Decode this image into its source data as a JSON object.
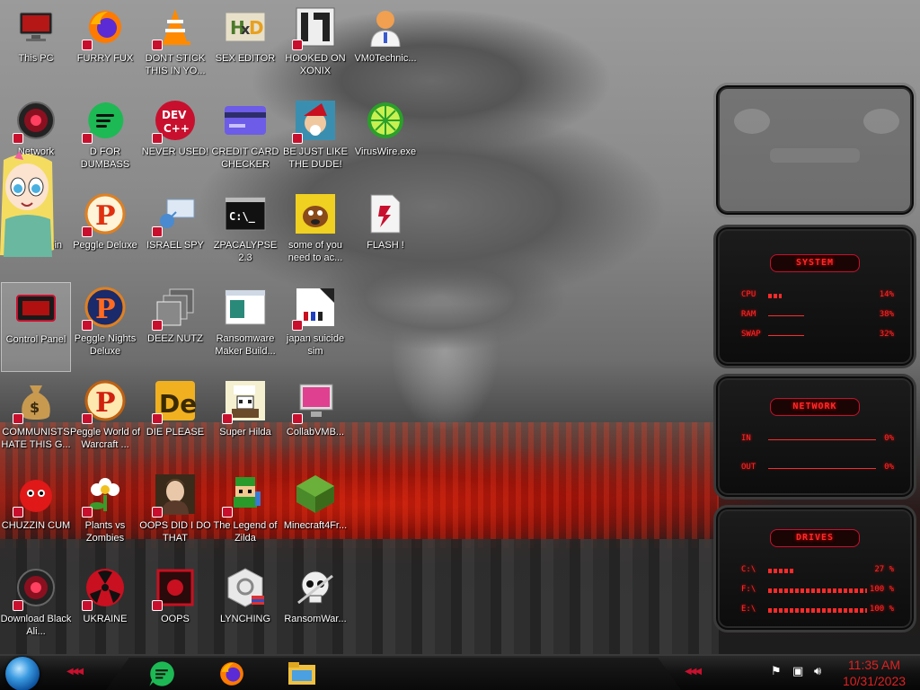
{
  "desktop": {
    "icons": [
      {
        "label": "This PC",
        "icon": "computer-icon"
      },
      {
        "label": "FURRY FUX",
        "icon": "firefox-icon"
      },
      {
        "label": "DONT STICK THIS IN YO...",
        "icon": "vlc-cone-icon"
      },
      {
        "label": "SEX EDITOR",
        "icon": "hxd-editor-icon"
      },
      {
        "label": "HOOKED ON XONIX",
        "icon": "xonix-game-icon"
      },
      {
        "label": "VM0Technic...",
        "icon": "technician-person-icon"
      },
      {
        "label": "Network",
        "icon": "network-orb-icon"
      },
      {
        "label": "D FOR DUMBASS",
        "icon": "green-chat-icon"
      },
      {
        "label": "NEVER USED!",
        "icon": "dev-cpp-icon"
      },
      {
        "label": "CREDIT CARD CHECKER",
        "icon": "credit-card-icon"
      },
      {
        "label": "BE JUST LIKE THE DUDE!",
        "icon": "elf-cartoon-icon"
      },
      {
        "label": "VirusWire.exe",
        "icon": "lime-icon"
      },
      {
        "label": "Recycle Bin",
        "icon": "recycle-bin-icon"
      },
      {
        "label": "Peggle Deluxe",
        "icon": "peggle-icon"
      },
      {
        "label": "ISRAEL SPY",
        "icon": "spy-network-icon"
      },
      {
        "label": "ZPACALYPSE 2.3",
        "icon": "terminal-icon"
      },
      {
        "label": "some of you need to ac...",
        "icon": "dog-cartoon-icon"
      },
      {
        "label": "FLASH !",
        "icon": "flash-document-icon"
      },
      {
        "label": "Control Panel",
        "icon": "control-panel-icon"
      },
      {
        "label": "Peggle Nights Deluxe",
        "icon": "peggle-nights-icon"
      },
      {
        "label": "DEEZ NUTZ",
        "icon": "stacked-windows-icon"
      },
      {
        "label": "Ransomware Maker Build...",
        "icon": "installer-window-icon"
      },
      {
        "label": "japan suicide sim",
        "icon": "sim-document-icon"
      },
      {
        "label": "COMMUNISTS HATE THIS G...",
        "icon": "money-bag-icon"
      },
      {
        "label": "Peggle World of Warcraft ...",
        "icon": "peggle-wow-icon"
      },
      {
        "label": "DIE PLEASE",
        "icon": "de-app-icon"
      },
      {
        "label": "Super Hilda",
        "icon": "pixel-character-icon"
      },
      {
        "label": "CollabVMB...",
        "icon": "monitor-icon"
      },
      {
        "label": "CHUZZIN CUM",
        "icon": "red-fuzzball-icon"
      },
      {
        "label": "Plants vs Zombies",
        "icon": "flower-icon"
      },
      {
        "label": "OOPS DID I DO THAT",
        "icon": "portrait-painting-icon"
      },
      {
        "label": "The Legend of Zilda",
        "icon": "pixel-hero-icon"
      },
      {
        "label": "Minecraft4Fr...",
        "icon": "minecraft-tree-icon"
      },
      {
        "label": "Download Black Ali...",
        "icon": "alien-orb-icon"
      },
      {
        "label": "UKRAINE",
        "icon": "radiation-icon"
      },
      {
        "label": "OOPS",
        "icon": "red-frame-icon"
      },
      {
        "label": "LYNCHING",
        "icon": "lynch-knot-icon"
      },
      {
        "label": "RansomWar...",
        "icon": "skull-icon"
      }
    ]
  },
  "gadgets": {
    "system": {
      "title": "SYSTEM",
      "rows": [
        {
          "key": "CPU",
          "value": "14%",
          "fill": 0.14
        },
        {
          "key": "RAM",
          "value": "38%",
          "fill": 0.38
        },
        {
          "key": "SWAP",
          "value": "32%",
          "fill": 0.32
        }
      ]
    },
    "network": {
      "title": "NETWORK",
      "rows": [
        {
          "key": "IN",
          "value": "0%"
        },
        {
          "key": "OUT",
          "value": "0%"
        }
      ]
    },
    "drives": {
      "title": "DRIVES",
      "rows": [
        {
          "key": "C:\\",
          "value": "27 %",
          "fill": 0.27
        },
        {
          "key": "F:\\",
          "value": "100 %",
          "fill": 1.0
        },
        {
          "key": "E:\\",
          "value": "100 %",
          "fill": 1.0
        }
      ]
    }
  },
  "taskbar": {
    "pinned": [
      {
        "icon": "green-chat-icon"
      },
      {
        "icon": "firefox-icon"
      },
      {
        "icon": "file-explorer-icon"
      }
    ],
    "tray": [
      {
        "icon": "flag-icon"
      },
      {
        "icon": "network-icon"
      },
      {
        "icon": "volume-icon"
      }
    ],
    "clock": {
      "time": "11:35 AM",
      "date": "10/31/2023"
    }
  },
  "colors": {
    "accent_red": "#ff2a2a",
    "shortcut_badge": "#c8102e",
    "clock_red": "#e02020"
  }
}
